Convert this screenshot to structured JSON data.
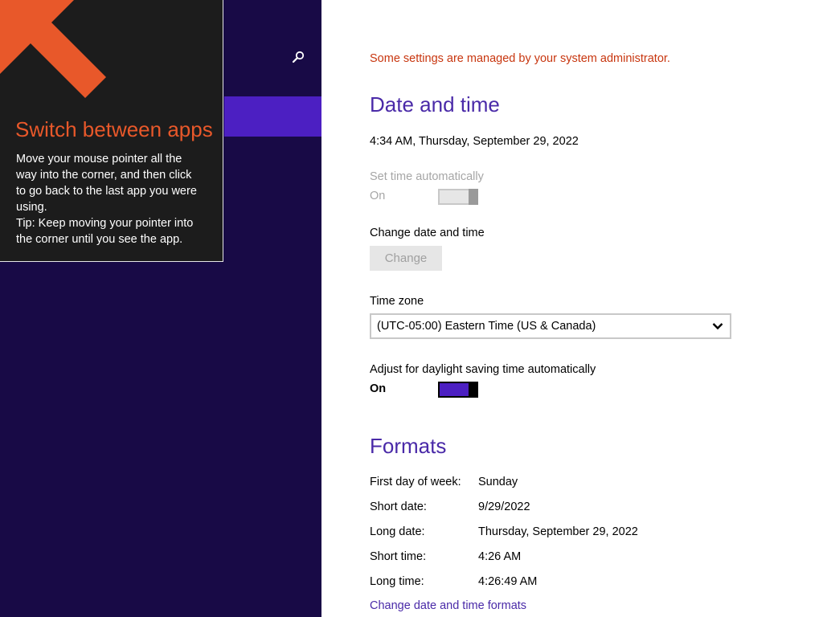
{
  "left_pane": {
    "search_icon": "search-icon",
    "colors": {
      "background": "#180a46",
      "selected": "#4c1fc2"
    }
  },
  "tip": {
    "arrow_icon": "arrow-up-left-icon",
    "title": "Switch between apps",
    "body_lines": [
      "Move your mouse pointer all the",
      "way into the corner, and then click",
      "to go back to the last app you were",
      "using.",
      "Tip: Keep moving your pointer into",
      "the corner until you see the app."
    ],
    "colors": {
      "accent": "#e8582a",
      "background": "#1c1c1c"
    }
  },
  "content": {
    "admin_notice": "Some settings are managed by your system administrator.",
    "date_time": {
      "heading": "Date and time",
      "current": "4:34 AM, Thursday, September 29, 2022",
      "set_time_auto": {
        "label": "Set time automatically",
        "state": "On",
        "enabled": false
      },
      "change_section": {
        "label": "Change date and time",
        "button": "Change"
      },
      "time_zone": {
        "label": "Time zone",
        "value": "(UTC-05:00) Eastern Time (US & Canada)"
      },
      "dst": {
        "label": "Adjust for daylight saving time automatically",
        "state": "On",
        "enabled": true
      }
    },
    "formats": {
      "heading": "Formats",
      "rows": [
        {
          "label": "First day of week:",
          "value": "Sunday"
        },
        {
          "label": "Short date:",
          "value": "9/29/2022"
        },
        {
          "label": "Long date:",
          "value": "Thursday, September 29, 2022"
        },
        {
          "label": "Short time:",
          "value": "4:26 AM"
        },
        {
          "label": "Long time:",
          "value": "4:26:49 AM"
        }
      ],
      "link": "Change date and time formats"
    },
    "colors": {
      "heading": "#4a2aa8",
      "notice": "#c8360f",
      "toggle_on": "#4c1fc2"
    }
  }
}
